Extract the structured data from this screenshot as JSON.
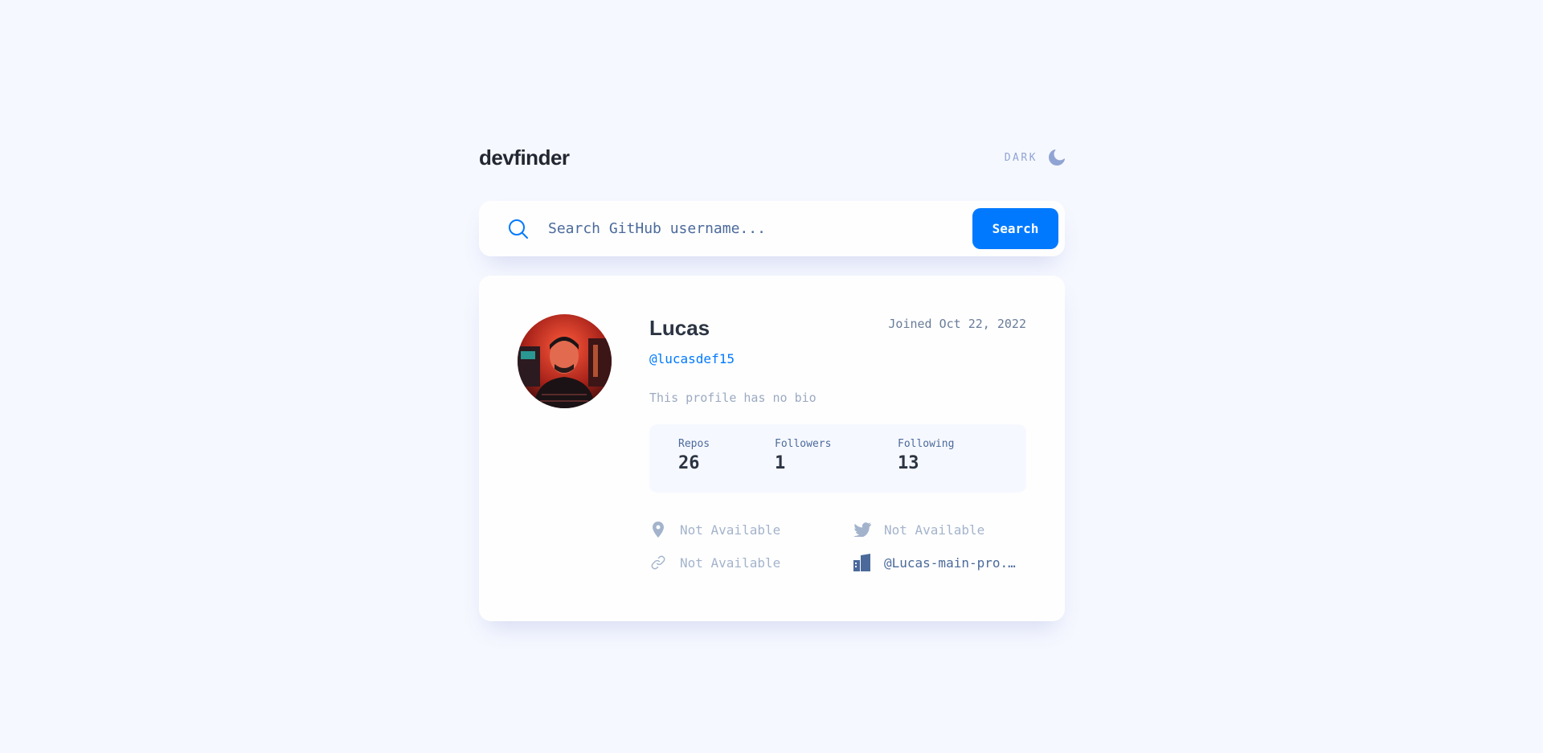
{
  "header": {
    "logo": "devfinder",
    "theme_label": "DARK",
    "theme_icon": "moon-icon"
  },
  "search": {
    "placeholder": "Search GitHub username...",
    "value": "",
    "button_label": "Search",
    "icon": "search-icon"
  },
  "profile": {
    "name": "Lucas",
    "joined": "Joined Oct 22, 2022",
    "login": "@lucasdef15",
    "bio": "This profile has no bio",
    "stats": [
      {
        "label": "Repos",
        "value": "26"
      },
      {
        "label": "Followers",
        "value": "1"
      },
      {
        "label": "Following",
        "value": "13"
      }
    ],
    "links": [
      {
        "icon": "location-icon",
        "text": "Not Available",
        "available": false
      },
      {
        "icon": "twitter-icon",
        "text": "Not Available",
        "available": false
      },
      {
        "icon": "website-link-icon",
        "text": "Not Available",
        "available": false
      },
      {
        "icon": "company-icon",
        "text": "@Lucas-main-pro...",
        "available": true
      }
    ]
  },
  "colors": {
    "background": "#f6f8ff",
    "accent": "#0079ff",
    "text": "#4b6a9b",
    "heading": "#2b3442",
    "muted": "#90a4d4"
  }
}
